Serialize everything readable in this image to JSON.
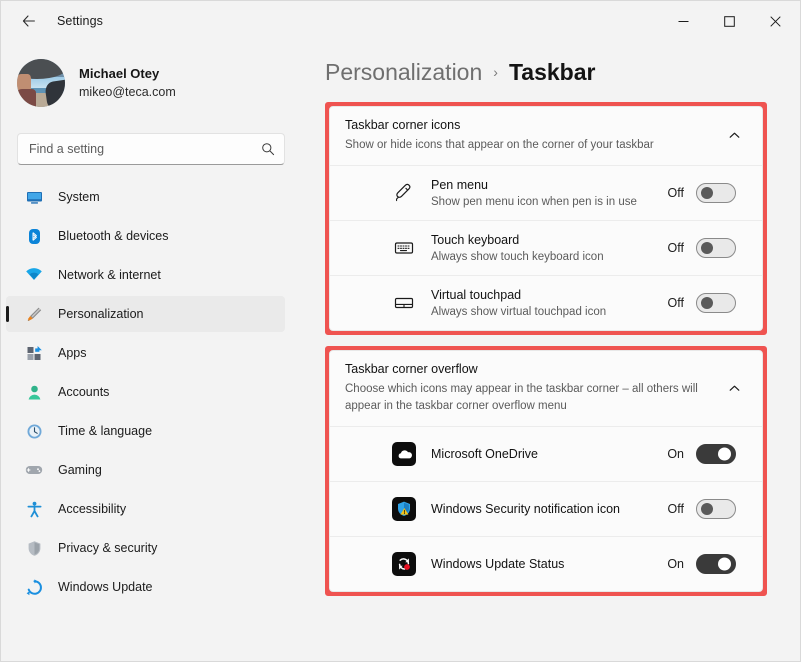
{
  "window": {
    "title": "Settings",
    "back_label": "back-arrow",
    "controls": {
      "minimize": "–",
      "maximize": "□",
      "close": "✕"
    }
  },
  "sidebar": {
    "account": {
      "name": "Michael Otey",
      "email": "mikeo@teca.com",
      "avatar": "user-photo"
    },
    "search": {
      "placeholder": "Find a setting",
      "value": "",
      "icon": "search-icon"
    },
    "items": [
      {
        "label": "System",
        "icon": "monitor-icon",
        "selected": false
      },
      {
        "label": "Bluetooth & devices",
        "icon": "bluetooth-icon",
        "selected": false
      },
      {
        "label": "Network & internet",
        "icon": "wifi-icon",
        "selected": false
      },
      {
        "label": "Personalization",
        "icon": "paintbrush-icon",
        "selected": true
      },
      {
        "label": "Apps",
        "icon": "apps-icon",
        "selected": false
      },
      {
        "label": "Accounts",
        "icon": "person-icon",
        "selected": false
      },
      {
        "label": "Time & language",
        "icon": "clock-icon",
        "selected": false
      },
      {
        "label": "Gaming",
        "icon": "gamepad-icon",
        "selected": false
      },
      {
        "label": "Accessibility",
        "icon": "accessibility-icon",
        "selected": false
      },
      {
        "label": "Privacy & security",
        "icon": "shield-icon",
        "selected": false
      },
      {
        "label": "Windows Update",
        "icon": "update-icon",
        "selected": false
      }
    ]
  },
  "main": {
    "breadcrumb": {
      "parent": "Personalization",
      "separator": "›",
      "current": "Taskbar"
    },
    "cards": [
      {
        "title": "Taskbar corner icons",
        "description": "Show or hide icons that appear on the corner of your taskbar",
        "chevron": "chevron-up-icon",
        "rows": [
          {
            "title": "Pen menu",
            "description": "Show pen menu icon when pen is in use",
            "icon": "pen-icon",
            "state": "Off",
            "on": false
          },
          {
            "title": "Touch keyboard",
            "description": "Always show touch keyboard icon",
            "icon": "keyboard-icon",
            "state": "Off",
            "on": false
          },
          {
            "title": "Virtual touchpad",
            "description": "Always show virtual touchpad icon",
            "icon": "touchpad-icon",
            "state": "Off",
            "on": false
          }
        ]
      },
      {
        "title": "Taskbar corner overflow",
        "description": "Choose which icons may appear in the taskbar corner – all others will appear in the taskbar corner overflow menu",
        "chevron": "chevron-up-icon",
        "rows": [
          {
            "title": "Microsoft OneDrive",
            "description": "",
            "icon": "onedrive-icon",
            "state": "On",
            "on": true
          },
          {
            "title": "Windows Security notification icon",
            "description": "",
            "icon": "windows-security-icon",
            "state": "Off",
            "on": false
          },
          {
            "title": "Windows Update Status",
            "description": "",
            "icon": "windows-update-icon",
            "state": "On",
            "on": true
          }
        ]
      }
    ]
  },
  "colors": {
    "annotation": "#ef5350",
    "accent_selected": "#1b1b1b",
    "toggle_on": "#3a3a3a",
    "page_bg": "#f3f3f3",
    "card_bg": "#fbfbfb"
  }
}
